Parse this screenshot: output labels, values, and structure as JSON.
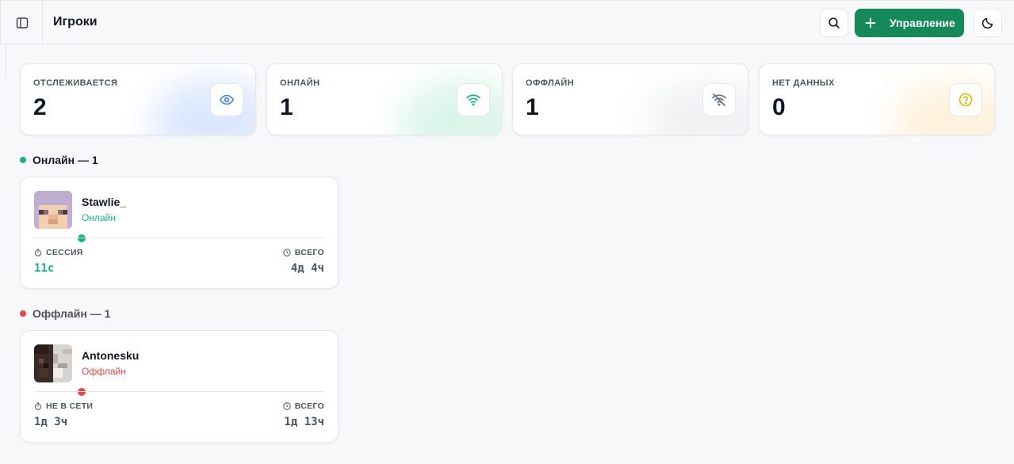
{
  "header": {
    "title": "Игроки",
    "manage_label": "Управление"
  },
  "stats": [
    {
      "label": "ОТСЛЕЖИВАЕТСЯ",
      "value": "2",
      "icon": "eye-icon",
      "color": "#3b82f6"
    },
    {
      "label": "ОНЛАЙН",
      "value": "1",
      "icon": "wifi-icon",
      "color": "#10b981"
    },
    {
      "label": "ОФФЛАЙН",
      "value": "1",
      "icon": "wifi-off-icon",
      "color": "#6b7280"
    },
    {
      "label": "НЕТ ДАННЫХ",
      "value": "0",
      "icon": "question-circle-icon",
      "color": "#eab308"
    }
  ],
  "sections": {
    "online": {
      "title": "Онлайн — 1",
      "color": "#10b981"
    },
    "offline": {
      "title": "Оффлайн — 1",
      "color": "#ef4444"
    }
  },
  "players": [
    {
      "name": "Stawlie_",
      "status": "Онлайн",
      "status_color": "#10b981",
      "left_label": "СЕССИЯ",
      "left_value": "11с",
      "left_value_color": "#10b981",
      "right_label": "ВСЕГО",
      "right_value": "4д 4ч"
    },
    {
      "name": "Antonesku",
      "status": "Оффлайн",
      "status_color": "#ef4444",
      "left_label": "НЕ В СЕТИ",
      "left_value": "1д 3ч",
      "left_value_color": "#4b5563",
      "right_label": "ВСЕГО",
      "right_value": "1д 13ч"
    }
  ],
  "colors": {
    "accent": "#16895a",
    "online": "#10b981",
    "offline": "#ef4444"
  }
}
